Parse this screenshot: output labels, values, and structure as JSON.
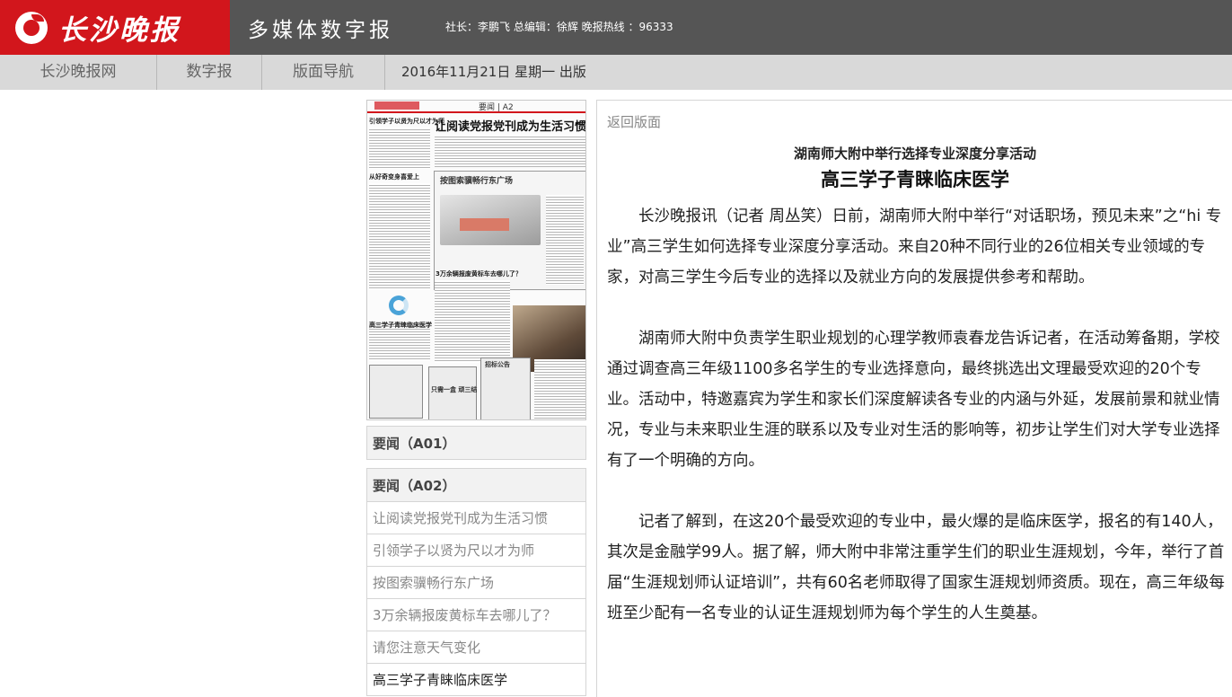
{
  "header": {
    "logo_text": "长沙晚报",
    "title": "多媒体数字报",
    "staff_info": "社长：李鹏飞 总编辑：徐辉 晚报热线 ：96333"
  },
  "nav": {
    "items": [
      {
        "label": "长沙晚报网"
      },
      {
        "label": "数字报"
      },
      {
        "label": "版面导航"
      }
    ],
    "date": "2016年11月21日 星期一 出版"
  },
  "thumbnail": {
    "section": "要闻",
    "page": "A2",
    "headline": "让阅读党报党刊成为生活习惯",
    "box_title": "按图索骥畅行东广场",
    "sub_1": "引领学子以贤为尺以才为师",
    "sub_2": "从好奇变身喜爱上",
    "sub_3": "3万余辆报废黄标车去哪儿了？",
    "sub_4": "高三学子青睐临床医学",
    "ad_1": "招标公告",
    "ad_2": "只需一盒 顽三结"
  },
  "pages": [
    {
      "title": "要闻（A01）",
      "articles": []
    },
    {
      "title": "要闻（A02）",
      "articles": [
        "让阅读党报党刊成为生活习惯",
        "引领学子以贤为尺以才为师",
        "按图索骥畅行东广场",
        "3万余辆报废黄标车去哪儿了？",
        "请您注意天气变化",
        "高三学子青睐临床医学"
      ]
    }
  ],
  "article": {
    "back_label": "返回版面",
    "subtitle": "湖南师大附中举行选择专业深度分享活动",
    "headline": "高三学子青睐临床医学",
    "paragraphs": [
      "长沙晚报讯（记者 周丛笑）日前，湖南师大附中举行“对话职场，预见未来”之“hi 专业”高三学生如何选择专业深度分享活动。来自20种不同行业的26位相关专业领域的专家，对高三学生今后专业的选择以及就业方向的发展提供参考和帮助。",
      "湖南师大附中负责学生职业规划的心理学教师袁春龙告诉记者，在活动筹备期，学校通过调查高三年级1100多名学生的专业选择意向，最终挑选出文理最受欢迎的20个专业。活动中，特邀嘉宾为学生和家长们深度解读各专业的内涵与外延，发展前景和就业情况，专业与未来职业生涯的联系以及专业对生活的影响等，初步让学生们对大学专业选择有了一个明确的方向。",
      "记者了解到，在这20个最受欢迎的专业中，最火爆的是临床医学，报名的有140人，其次是金融学99人。据了解，师大附中非常注重学生们的职业生涯规划，今年，举行了首届“生涯规划师认证培训”，共有60名老师取得了国家生涯规划师资质。现在，高三年级每班至少配有一名专业的认证生涯规划师为每个学生的人生奠基。"
    ]
  }
}
